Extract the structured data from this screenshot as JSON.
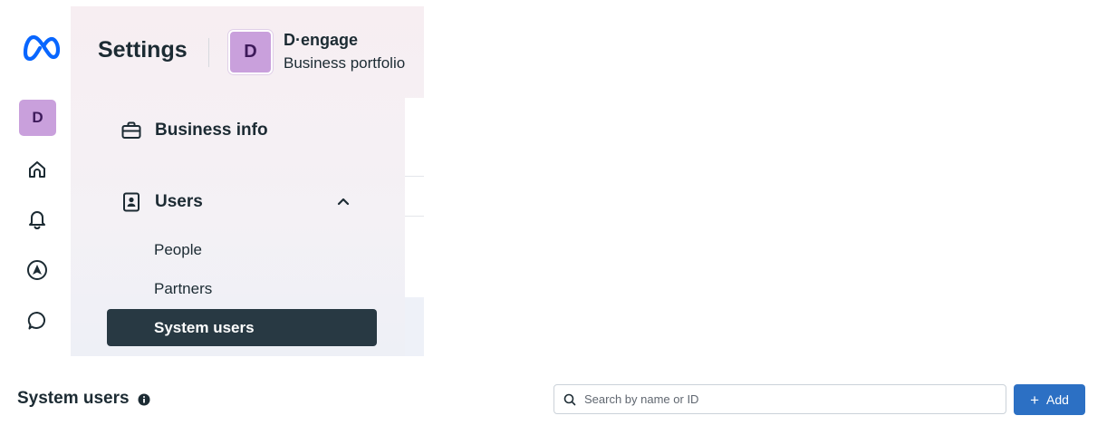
{
  "rail": {
    "logo_icon": "meta-logo-icon",
    "avatar_letter": "D",
    "icons": [
      "home-icon",
      "bell-icon",
      "navigation-icon",
      "chat-bubble-icon"
    ]
  },
  "header": {
    "title": "Settings",
    "business_initial": "D",
    "business_name": "D·engage",
    "business_subtitle": "Business portfolio"
  },
  "nav": {
    "business_info": "Business info",
    "users": "Users",
    "users_items": [
      "People",
      "Partners",
      "System users"
    ],
    "active_item": "System users"
  },
  "toolbar": {
    "section_title": "System users",
    "search_placeholder": "Search by name or ID",
    "add_label": "Add"
  },
  "colors": {
    "brand": "#0866ff",
    "avatar": "#c9a0dc",
    "active_nav": "#283943",
    "add_button": "#2c70c4"
  }
}
